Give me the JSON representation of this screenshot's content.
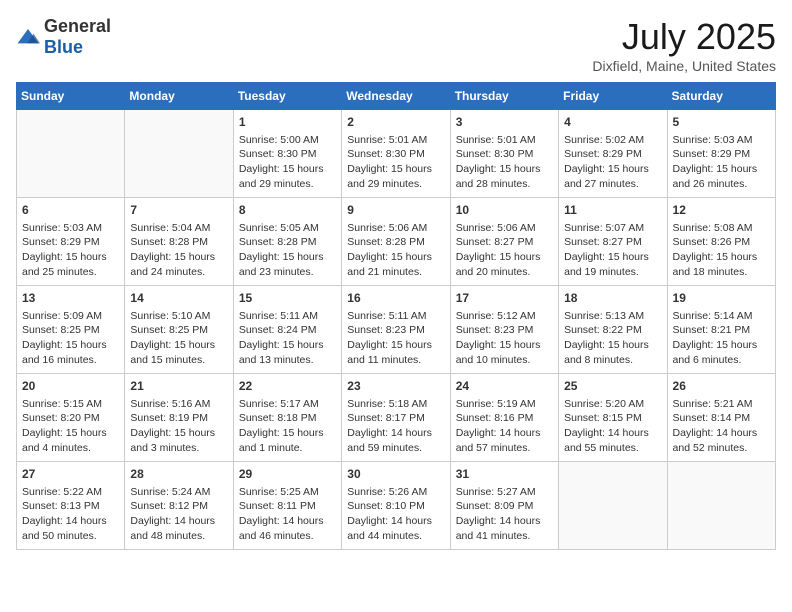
{
  "logo": {
    "general": "General",
    "blue": "Blue"
  },
  "title": "July 2025",
  "location": "Dixfield, Maine, United States",
  "weekdays": [
    "Sunday",
    "Monday",
    "Tuesday",
    "Wednesday",
    "Thursday",
    "Friday",
    "Saturday"
  ],
  "weeks": [
    [
      {
        "day": "",
        "info": ""
      },
      {
        "day": "",
        "info": ""
      },
      {
        "day": "1",
        "info": "Sunrise: 5:00 AM\nSunset: 8:30 PM\nDaylight: 15 hours and 29 minutes."
      },
      {
        "day": "2",
        "info": "Sunrise: 5:01 AM\nSunset: 8:30 PM\nDaylight: 15 hours and 29 minutes."
      },
      {
        "day": "3",
        "info": "Sunrise: 5:01 AM\nSunset: 8:30 PM\nDaylight: 15 hours and 28 minutes."
      },
      {
        "day": "4",
        "info": "Sunrise: 5:02 AM\nSunset: 8:29 PM\nDaylight: 15 hours and 27 minutes."
      },
      {
        "day": "5",
        "info": "Sunrise: 5:03 AM\nSunset: 8:29 PM\nDaylight: 15 hours and 26 minutes."
      }
    ],
    [
      {
        "day": "6",
        "info": "Sunrise: 5:03 AM\nSunset: 8:29 PM\nDaylight: 15 hours and 25 minutes."
      },
      {
        "day": "7",
        "info": "Sunrise: 5:04 AM\nSunset: 8:28 PM\nDaylight: 15 hours and 24 minutes."
      },
      {
        "day": "8",
        "info": "Sunrise: 5:05 AM\nSunset: 8:28 PM\nDaylight: 15 hours and 23 minutes."
      },
      {
        "day": "9",
        "info": "Sunrise: 5:06 AM\nSunset: 8:28 PM\nDaylight: 15 hours and 21 minutes."
      },
      {
        "day": "10",
        "info": "Sunrise: 5:06 AM\nSunset: 8:27 PM\nDaylight: 15 hours and 20 minutes."
      },
      {
        "day": "11",
        "info": "Sunrise: 5:07 AM\nSunset: 8:27 PM\nDaylight: 15 hours and 19 minutes."
      },
      {
        "day": "12",
        "info": "Sunrise: 5:08 AM\nSunset: 8:26 PM\nDaylight: 15 hours and 18 minutes."
      }
    ],
    [
      {
        "day": "13",
        "info": "Sunrise: 5:09 AM\nSunset: 8:25 PM\nDaylight: 15 hours and 16 minutes."
      },
      {
        "day": "14",
        "info": "Sunrise: 5:10 AM\nSunset: 8:25 PM\nDaylight: 15 hours and 15 minutes."
      },
      {
        "day": "15",
        "info": "Sunrise: 5:11 AM\nSunset: 8:24 PM\nDaylight: 15 hours and 13 minutes."
      },
      {
        "day": "16",
        "info": "Sunrise: 5:11 AM\nSunset: 8:23 PM\nDaylight: 15 hours and 11 minutes."
      },
      {
        "day": "17",
        "info": "Sunrise: 5:12 AM\nSunset: 8:23 PM\nDaylight: 15 hours and 10 minutes."
      },
      {
        "day": "18",
        "info": "Sunrise: 5:13 AM\nSunset: 8:22 PM\nDaylight: 15 hours and 8 minutes."
      },
      {
        "day": "19",
        "info": "Sunrise: 5:14 AM\nSunset: 8:21 PM\nDaylight: 15 hours and 6 minutes."
      }
    ],
    [
      {
        "day": "20",
        "info": "Sunrise: 5:15 AM\nSunset: 8:20 PM\nDaylight: 15 hours and 4 minutes."
      },
      {
        "day": "21",
        "info": "Sunrise: 5:16 AM\nSunset: 8:19 PM\nDaylight: 15 hours and 3 minutes."
      },
      {
        "day": "22",
        "info": "Sunrise: 5:17 AM\nSunset: 8:18 PM\nDaylight: 15 hours and 1 minute."
      },
      {
        "day": "23",
        "info": "Sunrise: 5:18 AM\nSunset: 8:17 PM\nDaylight: 14 hours and 59 minutes."
      },
      {
        "day": "24",
        "info": "Sunrise: 5:19 AM\nSunset: 8:16 PM\nDaylight: 14 hours and 57 minutes."
      },
      {
        "day": "25",
        "info": "Sunrise: 5:20 AM\nSunset: 8:15 PM\nDaylight: 14 hours and 55 minutes."
      },
      {
        "day": "26",
        "info": "Sunrise: 5:21 AM\nSunset: 8:14 PM\nDaylight: 14 hours and 52 minutes."
      }
    ],
    [
      {
        "day": "27",
        "info": "Sunrise: 5:22 AM\nSunset: 8:13 PM\nDaylight: 14 hours and 50 minutes."
      },
      {
        "day": "28",
        "info": "Sunrise: 5:24 AM\nSunset: 8:12 PM\nDaylight: 14 hours and 48 minutes."
      },
      {
        "day": "29",
        "info": "Sunrise: 5:25 AM\nSunset: 8:11 PM\nDaylight: 14 hours and 46 minutes."
      },
      {
        "day": "30",
        "info": "Sunrise: 5:26 AM\nSunset: 8:10 PM\nDaylight: 14 hours and 44 minutes."
      },
      {
        "day": "31",
        "info": "Sunrise: 5:27 AM\nSunset: 8:09 PM\nDaylight: 14 hours and 41 minutes."
      },
      {
        "day": "",
        "info": ""
      },
      {
        "day": "",
        "info": ""
      }
    ]
  ]
}
